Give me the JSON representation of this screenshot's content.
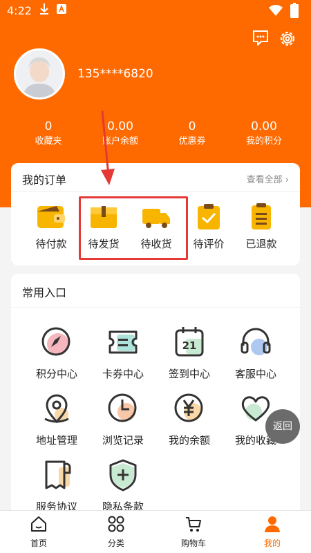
{
  "status": {
    "time": "4:22"
  },
  "profile": {
    "phone": "135****6820"
  },
  "stats": [
    {
      "value": "0",
      "label": "收藏夹"
    },
    {
      "value": "0.00",
      "label": "账户余额"
    },
    {
      "value": "0",
      "label": "优惠券"
    },
    {
      "value": "0.00",
      "label": "我的积分"
    }
  ],
  "orders": {
    "title": "我的订单",
    "view_all": "查看全部",
    "items": [
      {
        "label": "待付款",
        "icon": "wallet-icon"
      },
      {
        "label": "待发货",
        "icon": "box-icon"
      },
      {
        "label": "待收货",
        "icon": "truck-icon"
      },
      {
        "label": "待评价",
        "icon": "clipboard-check-icon"
      },
      {
        "label": "已退款",
        "icon": "list-doc-icon"
      }
    ]
  },
  "common": {
    "title": "常用入口",
    "items": [
      {
        "label": "积分中心",
        "icon": "compass-icon"
      },
      {
        "label": "卡券中心",
        "icon": "ticket-icon"
      },
      {
        "label": "签到中心",
        "icon": "calendar-icon"
      },
      {
        "label": "客服中心",
        "icon": "headset-icon"
      },
      {
        "label": "地址管理",
        "icon": "location-icon"
      },
      {
        "label": "浏览记录",
        "icon": "clock-icon"
      },
      {
        "label": "我的余额",
        "icon": "yen-icon"
      },
      {
        "label": "我的收藏",
        "icon": "heart-icon"
      },
      {
        "label": "服务协议",
        "icon": "document-icon"
      },
      {
        "label": "隐私条款",
        "icon": "shield-plus-icon"
      }
    ]
  },
  "back_button": "返回",
  "tabs": [
    {
      "label": "首页",
      "icon": "home-icon"
    },
    {
      "label": "分类",
      "icon": "category-icon"
    },
    {
      "label": "购物车",
      "icon": "cart-icon"
    },
    {
      "label": "我的",
      "icon": "user-icon"
    }
  ],
  "colors": {
    "accent": "#ff6a00",
    "highlight": "#e53935",
    "icon_yellow": "#f8b500"
  }
}
